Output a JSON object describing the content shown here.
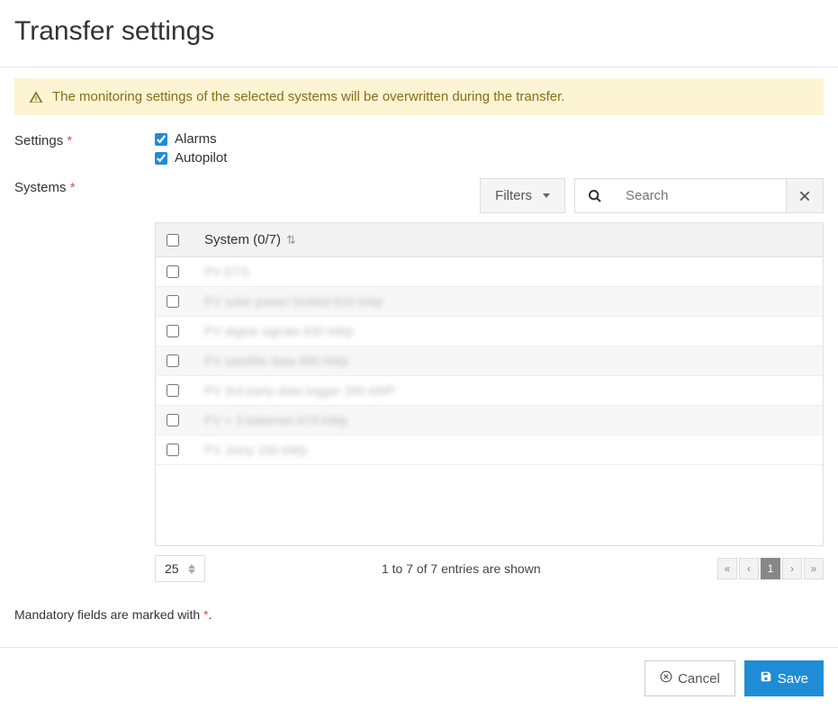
{
  "page": {
    "title": "Transfer settings"
  },
  "alert": {
    "text": "The monitoring settings of the selected systems will be overwritten during the transfer."
  },
  "form": {
    "settings_label": "Settings",
    "systems_label": "Systems",
    "settings_options": {
      "alarms": "Alarms",
      "autopilot": "Autopilot"
    }
  },
  "toolbar": {
    "filters_label": "Filters",
    "search_placeholder": "Search"
  },
  "table": {
    "header_label": "System (0/7)",
    "rows": [
      {
        "name": "PV ETS"
      },
      {
        "name": "PV solar power limited 624 kWp"
      },
      {
        "name": "PV digital signals 630 kWp"
      },
      {
        "name": "PV satellite data 890 kWp"
      },
      {
        "name": "PV 3rd party data logger 280 kWP"
      },
      {
        "name": "PV + 3 batteries 679 kWp"
      },
      {
        "name": "PV Jolny 100 kWp"
      }
    ]
  },
  "footer_table": {
    "page_size": "25",
    "entries_text": "1 to 7 of 7 entries are shown",
    "pagination": {
      "current": "1"
    }
  },
  "mandatory_note": {
    "prefix": "Mandatory fields are marked with ",
    "marker": "*",
    "suffix": "."
  },
  "actions": {
    "cancel": "Cancel",
    "save": "Save"
  }
}
